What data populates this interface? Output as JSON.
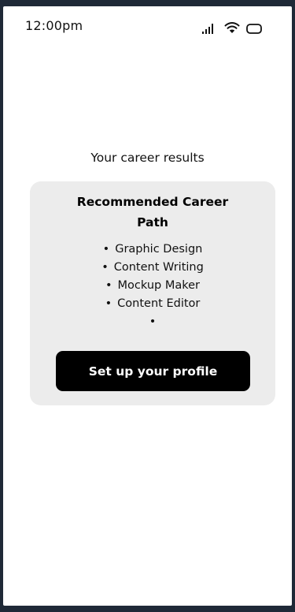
{
  "status_bar": {
    "time": "12:00pm",
    "icons": [
      "signal-icon",
      "wifi-icon",
      "battery-icon"
    ]
  },
  "main": {
    "title": "Your career results"
  },
  "card": {
    "heading_line1": "Recommended Career",
    "heading_line2": "Path",
    "bullet": "•",
    "careers": [
      {
        "label": "Graphic Design"
      },
      {
        "label": "Content Writing"
      },
      {
        "label": "Mockup Maker"
      },
      {
        "label": "Content Editor"
      }
    ],
    "button_label": "Set up your profile"
  },
  "colors": {
    "page_background": "#1f2937",
    "screen_background": "#ffffff",
    "card_background": "#ececec",
    "button_background": "#000000",
    "button_text": "#ffffff"
  }
}
